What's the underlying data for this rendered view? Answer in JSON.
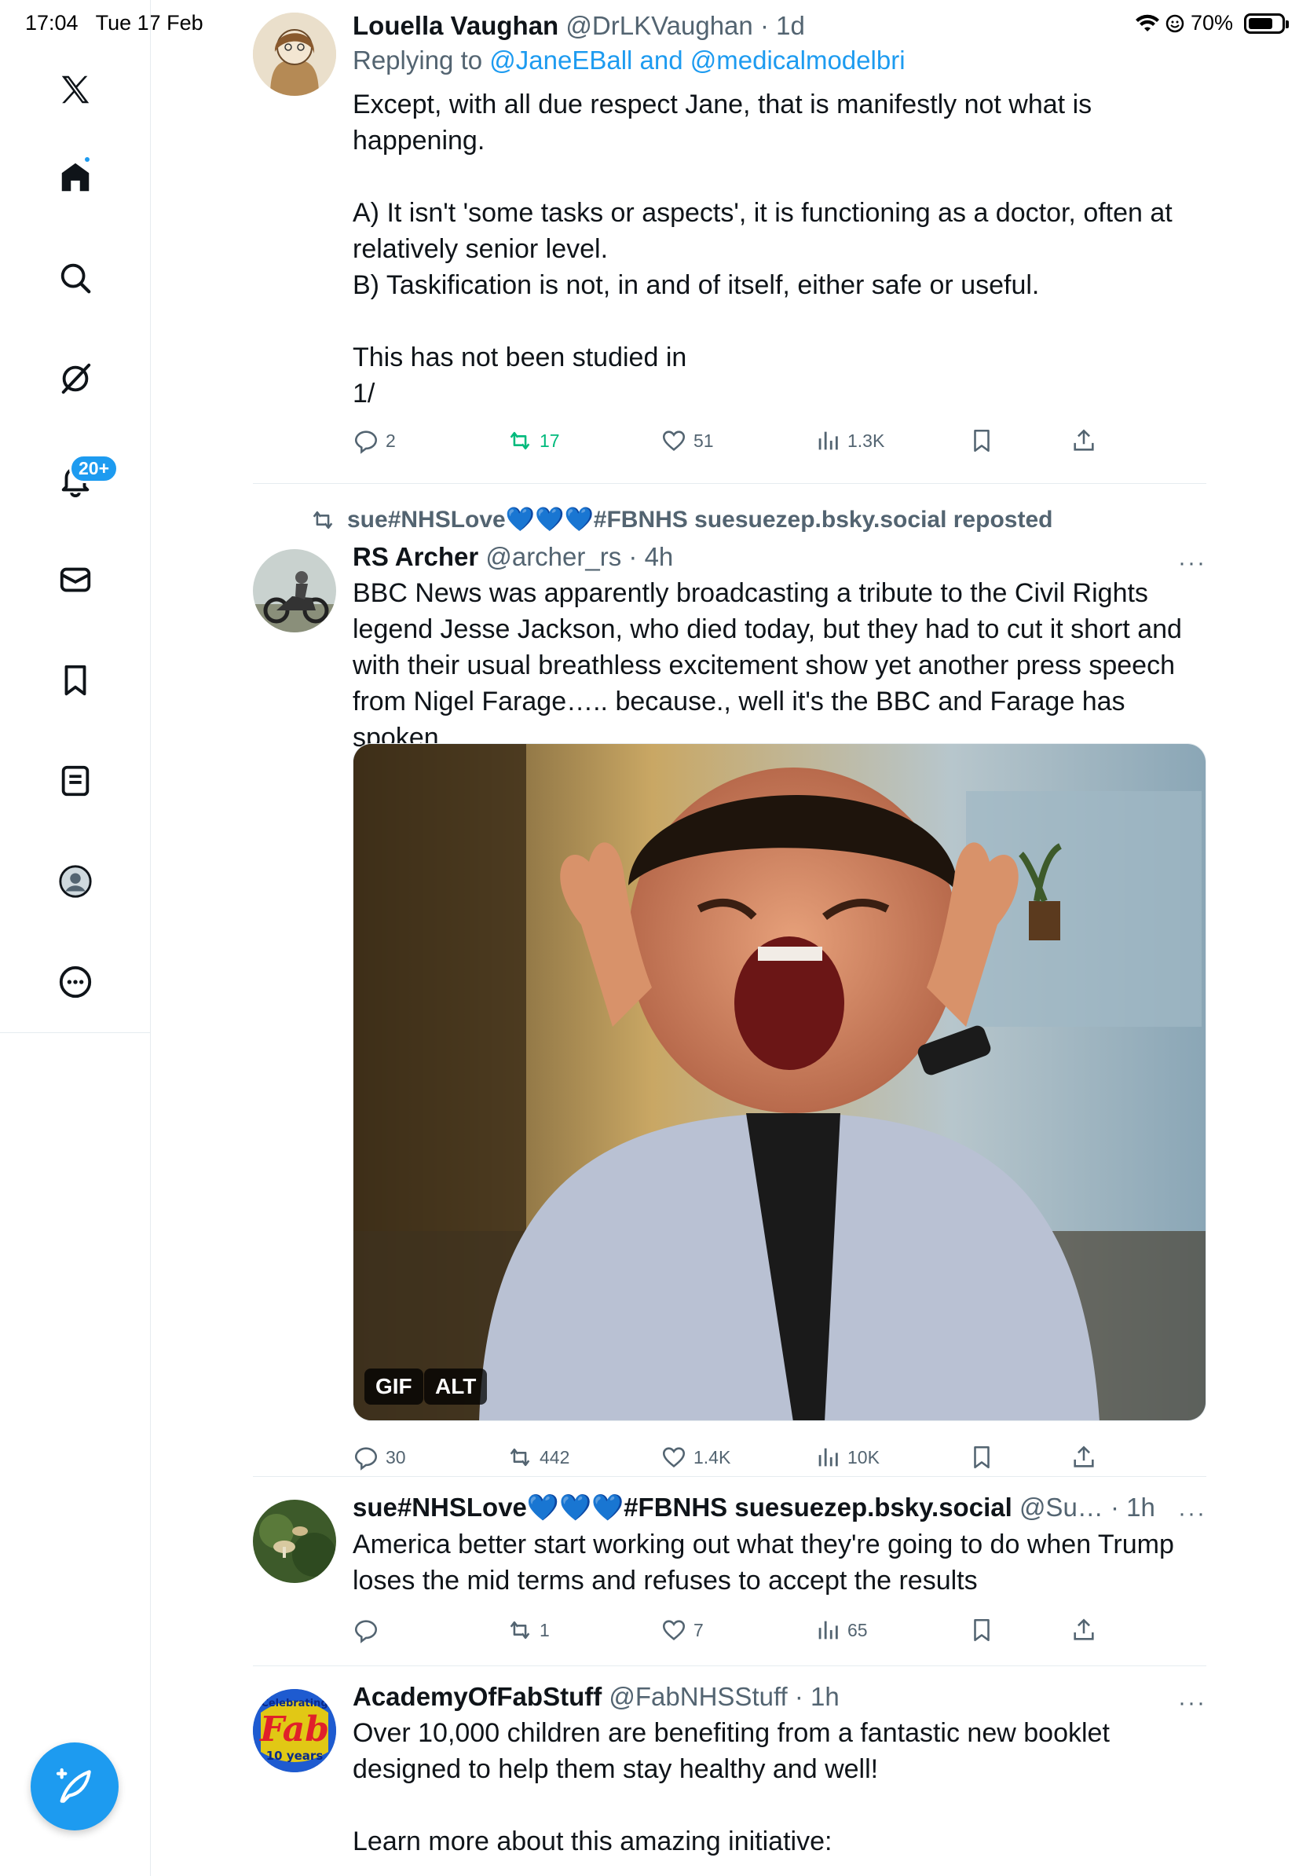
{
  "status": {
    "time": "17:04",
    "date": "Tue 17 Feb",
    "battery": "70%"
  },
  "sidebar": {
    "notifications_badge": "20+",
    "items": [
      "x-logo",
      "home",
      "search",
      "grok",
      "notifications",
      "messages",
      "bookmarks",
      "lists",
      "profile",
      "more"
    ]
  },
  "tweets": [
    {
      "name": "Louella Vaughan",
      "handle": "@DrLKVaughan",
      "time": "1d",
      "reply_prefix": "Replying to ",
      "reply_to": "@JaneEBall and @medicalmodelbri",
      "text": "Except, with all due respect Jane, that is manifestly not what is happening.\n\nA) It isn't 'some tasks or aspects', it is functioning as a doctor, often at relatively senior level.\nB) Taskification is not, in and of itself, either safe or useful.\n\nThis has not been studied in\n1/",
      "replies": "2",
      "reposts": "17",
      "likes": "51",
      "views": "1.3K"
    },
    {
      "repost_by": "sue#NHSLove💙💙💙#FBNHS suesuezep.bsky.social reposted",
      "name": "RS Archer",
      "handle": "@archer_rs",
      "time": "4h",
      "text": "BBC News was apparently broadcasting a tribute to the Civil Rights legend Jesse Jackson, who died today, but they had to cut it short and with their usual breathless excitement show yet another press speech from Nigel Farage….. because., well it's the BBC and Farage has spoken",
      "media_gif": "GIF",
      "media_alt": "ALT",
      "replies": "30",
      "reposts": "442",
      "likes": "1.4K",
      "views": "10K"
    },
    {
      "name": "sue#NHSLove💙💙💙#FBNHS suesuezep.bsky.social",
      "handle": "@Su…",
      "time": "1h",
      "text": "America better start working out what they're going to do when Trump loses the mid terms and refuses to accept the results",
      "replies": "",
      "reposts": "1",
      "likes": "7",
      "views": "65"
    },
    {
      "name": "AcademyOfFabStuff",
      "handle": "@FabNHSStuff",
      "time": "1h",
      "avatar_text_top": "Celebrating",
      "avatar_text_main": "Fab",
      "avatar_text_bottom": "10 years",
      "text": "Over 10,000 children are benefiting from a fantastic new booklet designed to help them stay healthy and well!\n\nLearn more about this amazing initiative:"
    }
  ],
  "dot_separator": "·",
  "more_label": "···",
  "colors": {
    "accent": "#1d9bf0",
    "muted": "#536471",
    "repost_green": "#00ba7c"
  }
}
